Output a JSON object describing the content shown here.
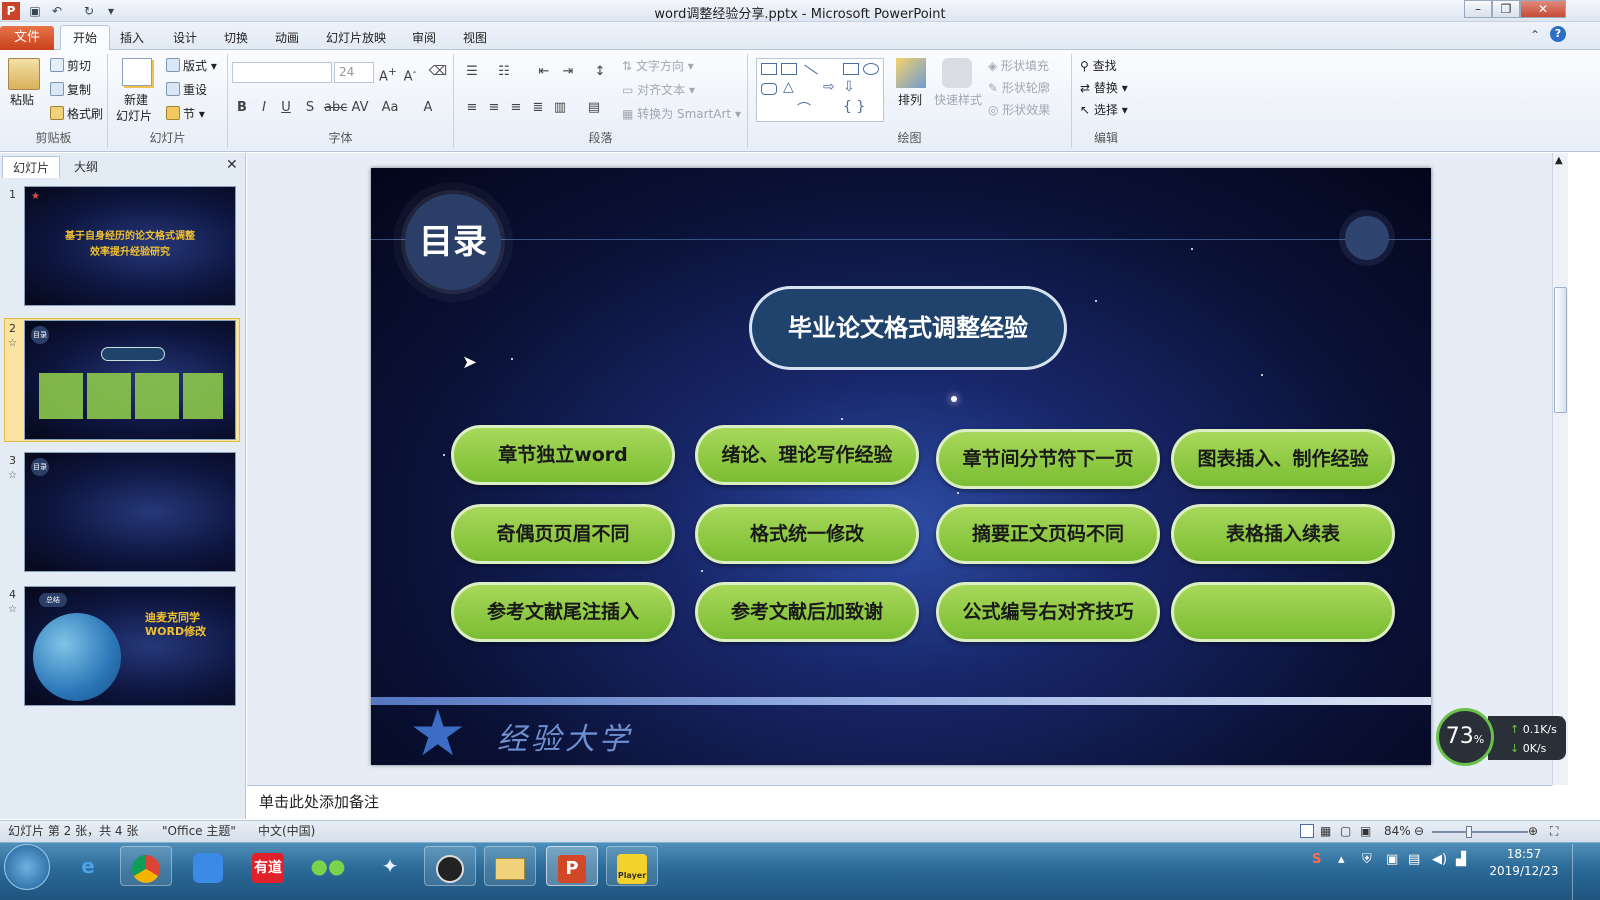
{
  "window": {
    "title": "word调整经验分享.pptx - Microsoft PowerPoint"
  },
  "tabs": [
    "文件",
    "开始",
    "插入",
    "设计",
    "切换",
    "动画",
    "幻灯片放映",
    "审阅",
    "视图"
  ],
  "ribbon": {
    "clipboard": {
      "label": "剪贴板",
      "paste": "粘贴",
      "cut": "剪切",
      "copy": "复制",
      "format_painter": "格式刷"
    },
    "slides": {
      "label": "幻灯片",
      "new_slide_1": "新建",
      "new_slide_2": "幻灯片",
      "layout": "版式",
      "reset": "重设",
      "section": "节"
    },
    "font": {
      "label": "字体",
      "size": "24"
    },
    "paragraph": {
      "label": "段落",
      "text_direction": "文字方向",
      "align_text": "对齐文本",
      "smartart": "转换为 SmartArt"
    },
    "drawing": {
      "label": "绘图",
      "arrange": "排列",
      "quick_styles": "快速样式",
      "shape_fill": "形状填充",
      "shape_outline": "形状轮廓",
      "shape_effects": "形状效果"
    },
    "editing": {
      "label": "编辑",
      "find": "查找",
      "replace": "替换",
      "select": "选择"
    }
  },
  "left_panel": {
    "tab_slides": "幻灯片",
    "tab_outline": "大纲",
    "slide_numbers": [
      "1",
      "2",
      "3",
      "4"
    ],
    "thumb1_title_1": "基于自身经历的论文格式调整",
    "thumb1_title_2": "效率提升经验研究",
    "thumb_toc": "目录",
    "thumb4_badge": "总结",
    "thumb4_title_1": "迪麦克同学",
    "thumb4_title_2": "WORD修改"
  },
  "slide": {
    "toc_label": "目录",
    "main_title": "毕业论文格式调整经验",
    "items": [
      "章节独立word",
      "绪论、理论写作经验",
      "章节间分节符下一页",
      "图表插入、制作经验",
      "奇偶页页眉不同",
      "格式统一修改",
      "摘要正文页码不同",
      "表格插入续表",
      "参考文献尾注插入",
      "参考文献后加致谢",
      "公式编号右对齐技巧",
      ""
    ],
    "footer_text": "经验大学"
  },
  "notes": {
    "placeholder": "单击此处添加备注"
  },
  "status": {
    "slide_info": "幻灯片 第 2 张，共 4 张",
    "theme": "\"Office 主题\"",
    "language": "中文(中国)",
    "zoom": "84%"
  },
  "net_widget": {
    "percent": "73",
    "percent_unit": "%",
    "up": "0.1K/s",
    "down": "0K/s"
  },
  "taskbar": {
    "youdao": "有道",
    "player": "Player",
    "time": "18:57",
    "date": "2019/12/23"
  }
}
